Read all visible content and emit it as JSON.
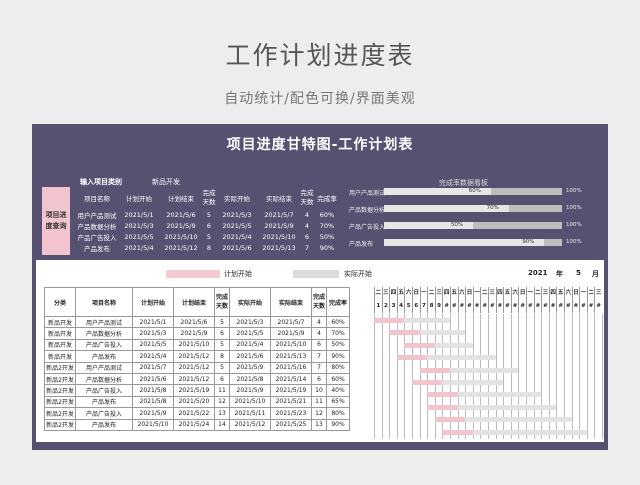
{
  "hero": {
    "title": "工作计划进度表",
    "subtitle": "自动统计/配色可换/界面美观"
  },
  "sheet": {
    "title": "项目进度甘特图-工作计划表"
  },
  "query": {
    "input_label": "输入项目类别",
    "input_value": "新品开发",
    "button_label": "项目进度查询",
    "columns": [
      "项目名称",
      "计划开始",
      "计划结束",
      "完成天数",
      "实际开始",
      "实际结束",
      "完成天数",
      "完成率"
    ],
    "rows": [
      [
        "用户产品测试",
        "2021/5/1",
        "2021/5/6",
        "5",
        "2021/5/3",
        "2021/5/7",
        "4",
        "60%"
      ],
      [
        "产品数据分析",
        "2021/5/3",
        "2021/5/9",
        "6",
        "2021/5/5",
        "2021/5/9",
        "4",
        "70%"
      ],
      [
        "产品广告投入",
        "2021/5/5",
        "2021/5/10",
        "5",
        "2021/5/4",
        "2021/5/10",
        "6",
        "50%"
      ],
      [
        "产品发布",
        "2021/5/4",
        "2021/5/12",
        "8",
        "2021/5/6",
        "2021/5/13",
        "7",
        "90%"
      ]
    ]
  },
  "dashboard": {
    "title": "完成率数据看板",
    "items": [
      {
        "label": "用户产品测试",
        "value": "60%",
        "fraction": 0.6,
        "max": "100%"
      },
      {
        "label": "产品数据分析",
        "value": "70%",
        "fraction": 0.7,
        "max": "100%"
      },
      {
        "label": "产品广告投入",
        "value": "50%",
        "fraction": 0.5,
        "max": "100%"
      },
      {
        "label": "产品发布",
        "value": "90%",
        "fraction": 0.9,
        "max": "100%"
      }
    ]
  },
  "gantt": {
    "legend_plan": "计划开始",
    "legend_actual": "实际开始",
    "year": "2021",
    "year_label": "年",
    "month": "5",
    "month_label": "月",
    "columns": [
      "分类",
      "项目名称",
      "计划开始",
      "计划结束",
      "完成天数",
      "实际开始",
      "实际结束",
      "完成天数",
      "完成率"
    ],
    "weekdays": [
      "二",
      "三",
      "四",
      "五",
      "六",
      "日",
      "一",
      "二",
      "三",
      "四",
      "五",
      "六",
      "日",
      "一",
      "二",
      "三",
      "四",
      "五",
      "六",
      "日",
      "一",
      "二",
      "三",
      "四",
      "五",
      "六",
      "日",
      "一",
      "二",
      "三"
    ],
    "days": [
      "1",
      "2",
      "3",
      "4",
      "5",
      "6",
      "7",
      "8",
      "9",
      "#",
      "#",
      "#",
      "#",
      "#",
      "#",
      "#",
      "#",
      "#",
      "#",
      "#",
      "#",
      "#",
      "#",
      "#",
      "#",
      "#",
      "#",
      "#",
      "#",
      "#"
    ],
    "rows": [
      {
        "cells": [
          "新品开发",
          "用户产品测试",
          "2021/5/1",
          "2021/5/6",
          "5",
          "2021/5/3",
          "2021/5/7",
          "4",
          "60%"
        ],
        "plan_start": 1,
        "plan_days": 5,
        "act_start": 3,
        "act_days": 4
      },
      {
        "cells": [
          "新品开发",
          "产品数据分析",
          "2021/5/3",
          "2021/5/9",
          "6",
          "2021/5/5",
          "2021/5/9",
          "4",
          "70%"
        ],
        "plan_start": 3,
        "plan_days": 6,
        "act_start": 5,
        "act_days": 4
      },
      {
        "cells": [
          "新品开发",
          "产品广告投入",
          "2021/5/5",
          "2021/5/10",
          "5",
          "2021/5/4",
          "2021/5/10",
          "6",
          "50%"
        ],
        "plan_start": 5,
        "plan_days": 5,
        "act_start": 4,
        "act_days": 6
      },
      {
        "cells": [
          "新品开发",
          "产品发布",
          "2021/5/4",
          "2021/5/12",
          "8",
          "2021/5/6",
          "2021/5/13",
          "7",
          "90%"
        ],
        "plan_start": 4,
        "plan_days": 8,
        "act_start": 6,
        "act_days": 7
      },
      {
        "cells": [
          "新品2开发",
          "用户产品测试",
          "2021/5/7",
          "2021/5/12",
          "5",
          "2021/5/9",
          "2021/5/16",
          "7",
          "80%"
        ],
        "plan_start": 7,
        "plan_days": 5,
        "act_start": 9,
        "act_days": 7
      },
      {
        "cells": [
          "新品2开发",
          "产品数据分析",
          "2021/5/6",
          "2021/5/12",
          "6",
          "2021/5/8",
          "2021/5/14",
          "6",
          "60%"
        ],
        "plan_start": 6,
        "plan_days": 6,
        "act_start": 8,
        "act_days": 6
      },
      {
        "cells": [
          "新品2开发",
          "产品广告投入",
          "2021/5/8",
          "2021/5/19",
          "11",
          "2021/5/9",
          "2021/5/19",
          "10",
          "40%"
        ],
        "plan_start": 8,
        "plan_days": 11,
        "act_start": 9,
        "act_days": 10
      },
      {
        "cells": [
          "新品2开发",
          "产品发布",
          "2021/5/8",
          "2021/5/20",
          "12",
          "2021/5/10",
          "2021/5/21",
          "11",
          "65%"
        ],
        "plan_start": 8,
        "plan_days": 12,
        "act_start": 10,
        "act_days": 11
      },
      {
        "cells": [
          "新品2开发",
          "产品广告投入",
          "2021/5/9",
          "2021/5/22",
          "13",
          "2021/5/11",
          "2021/5/23",
          "12",
          "80%"
        ],
        "plan_start": 9,
        "plan_days": 13,
        "act_start": 11,
        "act_days": 12
      },
      {
        "cells": [
          "新品2开发",
          "产品发布",
          "2021/5/10",
          "2021/5/24",
          "14",
          "2021/5/12",
          "2021/5/25",
          "13",
          "90%"
        ],
        "plan_start": 10,
        "plan_days": 14,
        "act_start": 12,
        "act_days": 13
      }
    ]
  }
}
